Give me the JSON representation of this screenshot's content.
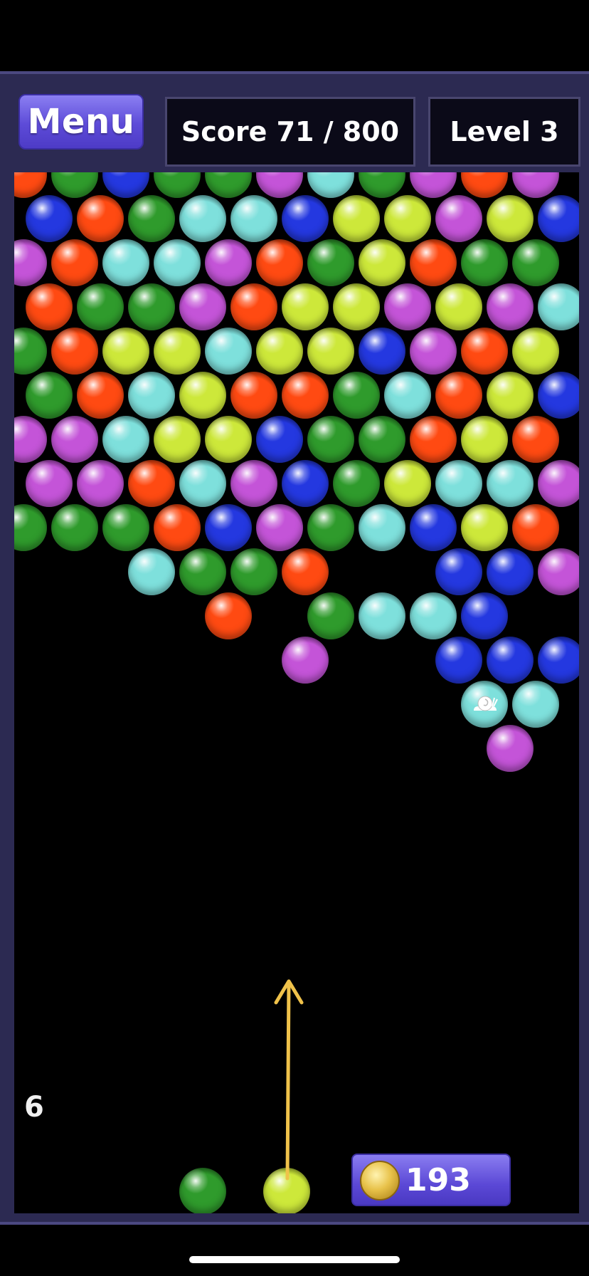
{
  "header": {
    "menu_label": "Menu",
    "score_text": "Score 71 / 800",
    "level_text": "Level 3"
  },
  "footer": {
    "shots_remaining": "6",
    "coin_count": "193",
    "coin_icon": "coin-icon"
  },
  "colors": {
    "orange": "#ff4a12",
    "green": "#2f9b2c",
    "blue": "#2438e0",
    "purple": "#c454d8",
    "cyan": "#7ee0dc",
    "yellow": "#cde83a",
    "frame": "#2c2a52",
    "accent": "#5d4bd8"
  },
  "board": {
    "rows": [
      "O G B G G P C G P O P",
      "B O G C C B Y Y P Y B",
      "P O C C P O G Y O G G",
      "O G G P O Y Y P Y P C",
      "G O Y Y C Y Y B P O Y",
      "G O C Y O O G C O Y B",
      "P P C Y Y B G G O Y O",
      "P P O C P B G Y C C P",
      "G G G O B P G C B Y O",
      ". . C G G O . . B B P",
      ". . . . O . G C C B .",
      ". . . . . P . . B B B",
      ". . . . . . . . . Cs C",
      ". . . . . . . . . P ."
    ],
    "special": "snail-icon"
  },
  "launcher": {
    "next_bubble": "G",
    "current_bubble": "Y"
  }
}
